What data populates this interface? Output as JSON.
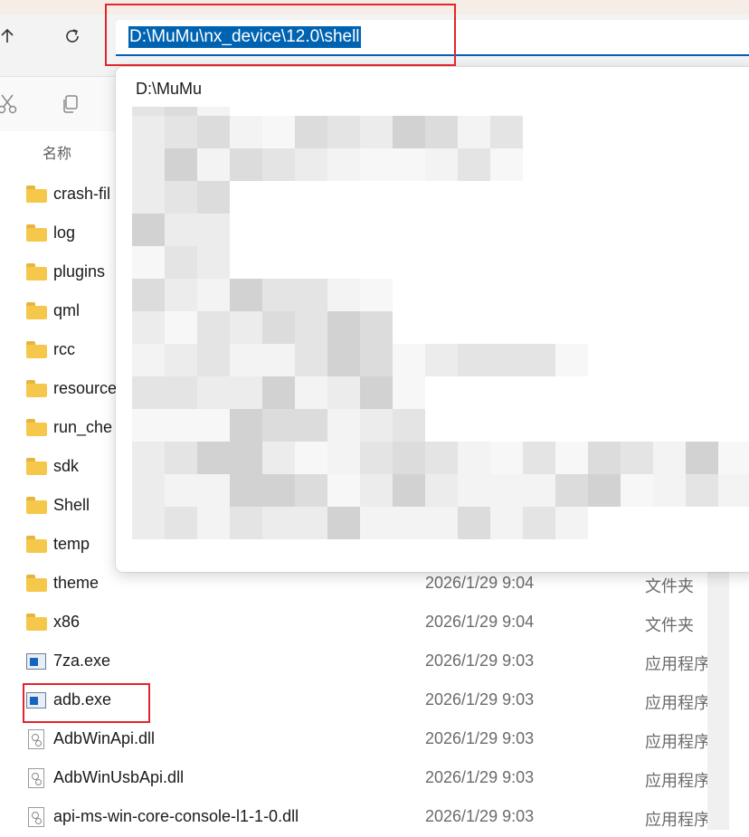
{
  "address_bar": {
    "path": "D:\\MuMu\\nx_device\\12.0\\shell"
  },
  "nav": {
    "up_icon": "arrow-up-icon",
    "refresh_icon": "refresh-icon"
  },
  "toolbar": {
    "cut_icon": "scissors-icon",
    "copy_icon": "copy-icon"
  },
  "columns": {
    "name": "名称"
  },
  "dropdown": {
    "first_item": "D:\\MuMu"
  },
  "files": [
    {
      "name": "crash-fil",
      "date": "",
      "type": "",
      "icon": "folder-icon"
    },
    {
      "name": "log",
      "date": "",
      "type": "",
      "icon": "folder-icon"
    },
    {
      "name": "plugins",
      "date": "",
      "type": "",
      "icon": "folder-icon"
    },
    {
      "name": "qml",
      "date": "",
      "type": "",
      "icon": "folder-icon"
    },
    {
      "name": "rcc",
      "date": "",
      "type": "",
      "icon": "folder-icon"
    },
    {
      "name": "resource",
      "date": "",
      "type": "",
      "icon": "folder-icon"
    },
    {
      "name": "run_che",
      "date": "",
      "type": "",
      "icon": "folder-icon"
    },
    {
      "name": "sdk",
      "date": "",
      "type": "",
      "icon": "folder-icon"
    },
    {
      "name": "Shell",
      "date": "",
      "type": "",
      "icon": "folder-icon"
    },
    {
      "name": "temp",
      "date": "",
      "type": "",
      "icon": "folder-icon"
    },
    {
      "name": "theme",
      "date": "2026/1/29 9:04",
      "type": "文件夹",
      "icon": "folder-icon"
    },
    {
      "name": "x86",
      "date": "2026/1/29 9:04",
      "type": "文件夹",
      "icon": "folder-icon"
    },
    {
      "name": "7za.exe",
      "date": "2026/1/29 9:03",
      "type": "应用程序",
      "icon": "exe-icon"
    },
    {
      "name": "adb.exe",
      "date": "2026/1/29 9:03",
      "type": "应用程序",
      "icon": "exe-icon"
    },
    {
      "name": "AdbWinApi.dll",
      "date": "2026/1/29 9:03",
      "type": "应用程序",
      "icon": "dll-icon"
    },
    {
      "name": "AdbWinUsbApi.dll",
      "date": "2026/1/29 9:03",
      "type": "应用程序",
      "icon": "dll-icon"
    },
    {
      "name": "api-ms-win-core-console-l1-1-0.dll",
      "date": "2026/1/29 9:03",
      "type": "应用程序",
      "icon": "dll-icon"
    }
  ],
  "colors": {
    "accent": "#0063b1",
    "highlight_box": "#e0262b",
    "folder": "#f5c84c"
  }
}
